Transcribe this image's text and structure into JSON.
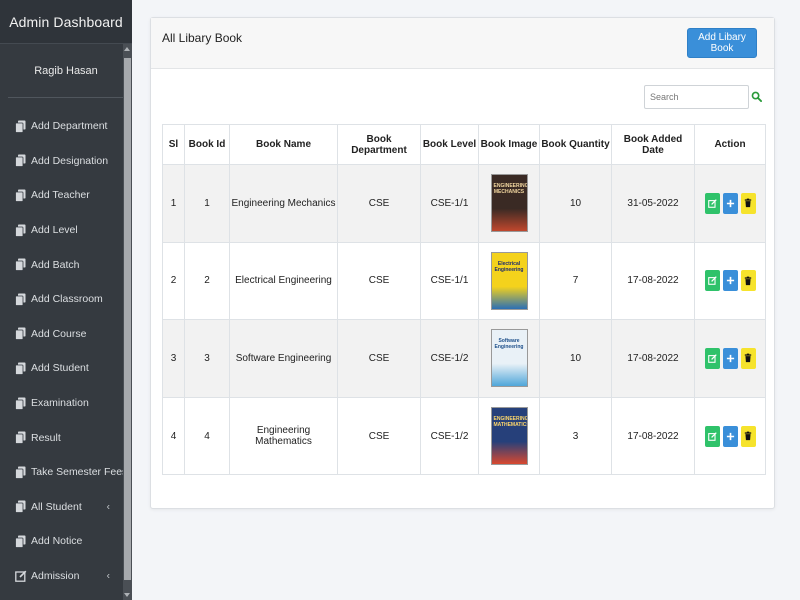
{
  "sidebar": {
    "title": "Admin Dashboard",
    "user_name": "Ragib Hasan",
    "items": [
      {
        "label": "Add Department",
        "icon": "copy-icon",
        "caret": ""
      },
      {
        "label": "Add Designation",
        "icon": "copy-icon",
        "caret": ""
      },
      {
        "label": "Add Teacher",
        "icon": "copy-icon",
        "caret": ""
      },
      {
        "label": "Add Level",
        "icon": "copy-icon",
        "caret": ""
      },
      {
        "label": "Add Batch",
        "icon": "copy-icon",
        "caret": ""
      },
      {
        "label": "Add Classroom",
        "icon": "copy-icon",
        "caret": ""
      },
      {
        "label": "Add Course",
        "icon": "copy-icon",
        "caret": ""
      },
      {
        "label": "Add Student",
        "icon": "copy-icon",
        "caret": ""
      },
      {
        "label": "Examination",
        "icon": "copy-icon",
        "caret": ""
      },
      {
        "label": "Result",
        "icon": "copy-icon",
        "caret": ""
      },
      {
        "label": "Take Semester Fees",
        "icon": "copy-icon",
        "caret": ""
      },
      {
        "label": "All Student",
        "icon": "copy-icon",
        "caret": "‹"
      },
      {
        "label": "Add Notice",
        "icon": "copy-icon",
        "caret": ""
      },
      {
        "label": "Admission",
        "icon": "edit-icon",
        "caret": "‹"
      }
    ]
  },
  "card": {
    "title": "All Libary Book",
    "add_button": "Add Libary Book",
    "search_placeholder": "Search"
  },
  "table": {
    "headers": [
      "Sl",
      "Book Id",
      "Book Name",
      "Book Department",
      "Book Level",
      "Book Image",
      "Book Quantity",
      "Book Added Date",
      "Action"
    ],
    "rows": [
      {
        "sl": "1",
        "id": "1",
        "name": "Engineering Mechanics",
        "department": "CSE",
        "level": "CSE-1/1",
        "quantity": "10",
        "date": "31-05-2022",
        "cover_title": "ENGINEERING MECHANICS",
        "cover_bg": "#3a2a24",
        "cover_fg": "#f2d7a0",
        "cover_accent": "#c0472d"
      },
      {
        "sl": "2",
        "id": "2",
        "name": "Electrical Engineering",
        "department": "CSE",
        "level": "CSE-1/1",
        "quantity": "7",
        "date": "17-08-2022",
        "cover_title": "Electrical Engineering",
        "cover_bg": "#f4d21c",
        "cover_fg": "#1d2b6e",
        "cover_accent": "#2b6fb5"
      },
      {
        "sl": "3",
        "id": "3",
        "name": "Software Engineering",
        "department": "CSE",
        "level": "CSE-1/2",
        "quantity": "10",
        "date": "17-08-2022",
        "cover_title": "Software Engineering",
        "cover_bg": "#e9f1f7",
        "cover_fg": "#1d4f8a",
        "cover_accent": "#4fa6d9"
      },
      {
        "sl": "4",
        "id": "4",
        "name": "Engineering Mathematics",
        "department": "CSE",
        "level": "CSE-1/2",
        "quantity": "3",
        "date": "17-08-2022",
        "cover_title": "ENGINEERING MATHEMATICS",
        "cover_bg": "#26407a",
        "cover_fg": "#ffd86b",
        "cover_accent": "#d8482f"
      }
    ]
  },
  "colors": {
    "sidebar_bg": "#353a40",
    "primary": "#3a8fd9",
    "edit": "#2fc26a",
    "delete": "#f6e32c"
  }
}
